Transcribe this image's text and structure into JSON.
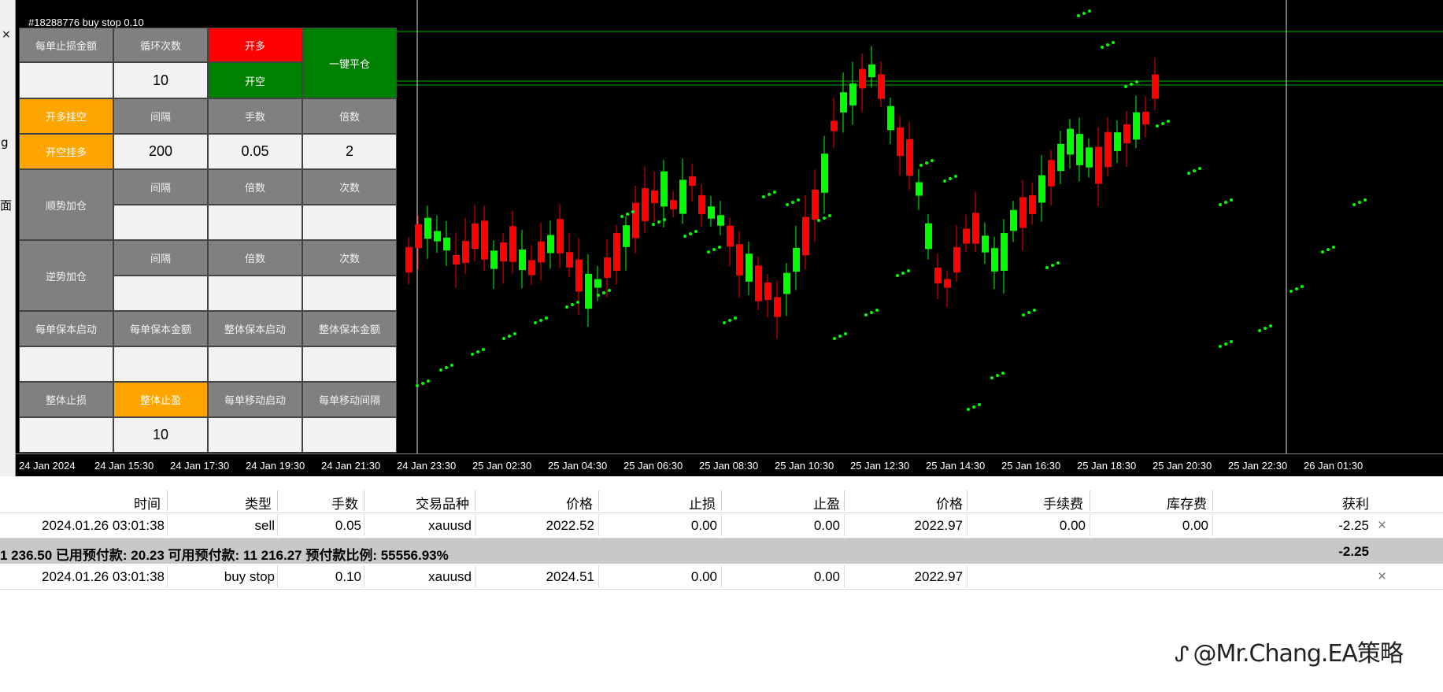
{
  "chart": {
    "order_tag": "#18288776 buy stop 0.10",
    "time_labels": [
      "24 Jan 2024",
      "24 Jan 15:30",
      "24 Jan 17:30",
      "24 Jan 19:30",
      "24 Jan 21:30",
      "24 Jan 23:30",
      "25 Jan 02:30",
      "25 Jan 04:30",
      "25 Jan 06:30",
      "25 Jan 08:30",
      "25 Jan 10:30",
      "25 Jan 12:30",
      "25 Jan 14:30",
      "25 Jan 16:30",
      "25 Jan 18:30",
      "25 Jan 20:30",
      "25 Jan 22:30",
      "26 Jan 01:30"
    ],
    "colors": {
      "background": "#000000",
      "bull": "#00ff00",
      "bear": "#ff0000",
      "sar": "#00ff00",
      "hline": "#00b000"
    }
  },
  "left_strip": {
    "close": "×",
    "frag1": "g",
    "frag2": "面"
  },
  "panel": {
    "per_order_sl_amount": "每单止损金额",
    "loop_count": "循环次数",
    "open_long": "开多",
    "open_short": "开空",
    "close_all": "一键平仓",
    "loop_count_value": "10",
    "long_pending_short": "开多挂空",
    "short_pending_long": "开空挂多",
    "interval": "间隔",
    "lots": "手数",
    "multiplier": "倍数",
    "interval_value": "200",
    "lots_value": "0.05",
    "multiplier_value": "2",
    "trend_add": "顺势加仓",
    "counter_add": "逆势加仓",
    "trend_interval": "间隔",
    "trend_multiplier": "倍数",
    "trend_count": "次数",
    "counter_interval": "间隔",
    "counter_multiplier": "倍数",
    "counter_count": "次数",
    "per_order_be_start": "每单保本启动",
    "per_order_be_amount": "每单保本金额",
    "total_be_start": "整体保本启动",
    "total_be_amount": "整体保本金额",
    "total_sl": "整体止损",
    "total_tp": "整体止盈",
    "per_order_trail_start": "每单移动启动",
    "per_order_trail_step": "每单移动间隔",
    "total_tp_value": "10"
  },
  "terminal": {
    "headers": [
      "时间",
      "类型",
      "手数",
      "交易品种",
      "价格",
      "止损",
      "止盈",
      "价格",
      "手续费",
      "库存费",
      "获利"
    ],
    "row1": [
      "2024.01.26 03:01:38",
      "sell",
      "0.05",
      "xauusd",
      "2022.52",
      "0.00",
      "0.00",
      "2022.97",
      "0.00",
      "0.00",
      "-2.25"
    ],
    "summary_text": "1 236.50  已用预付款: 20.23  可用预付款: 11 216.27  预付款比例: 55556.93%",
    "summary_profit": "-2.25",
    "row2": [
      "2024.01.26 03:01:38",
      "buy stop",
      "0.10",
      "xauusd",
      "2024.51",
      "0.00",
      "0.00",
      "2022.97",
      "",
      "",
      ""
    ],
    "close_icon": "×"
  },
  "watermark": {
    "logo": "ᔑ",
    "text": "@Mr.Chang.EA策略"
  }
}
